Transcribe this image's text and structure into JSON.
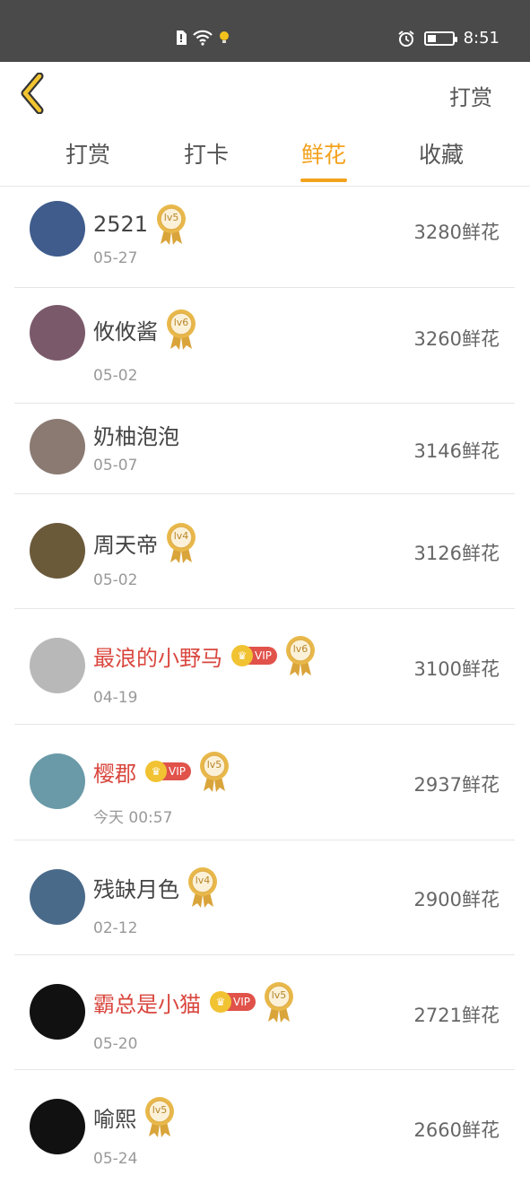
{
  "status_bar": {
    "time": "8:51",
    "battery_level": 0.35
  },
  "header": {
    "action_label": "打赏"
  },
  "tabs": [
    {
      "label": "打赏",
      "active": false
    },
    {
      "label": "打卡",
      "active": false
    },
    {
      "label": "鲜花",
      "active": true
    },
    {
      "label": "收藏",
      "active": false
    }
  ],
  "colors": {
    "accent": "#f3a21d",
    "vip_name": "#d9473f"
  },
  "list": [
    {
      "name": "2521",
      "vip": false,
      "level": "lv5",
      "date": "05-27",
      "amount": "3280鲜花",
      "avatar_bg": "#3f5c8c"
    },
    {
      "name": "攸攸酱",
      "vip": false,
      "level": "lv6",
      "date": "05-02",
      "amount": "3260鲜花",
      "avatar_bg": "#7a5a6a"
    },
    {
      "name": "奶柚泡泡",
      "vip": false,
      "level": "",
      "date": "05-07",
      "amount": "3146鲜花",
      "avatar_bg": "#8a7a72"
    },
    {
      "name": "周天帝",
      "vip": false,
      "level": "lv4",
      "date": "05-02",
      "amount": "3126鲜花",
      "avatar_bg": "#6b5a3a"
    },
    {
      "name": "最浪的小野马",
      "vip": true,
      "vip_label": "VIP",
      "level": "lv6",
      "date": "04-19",
      "amount": "3100鲜花",
      "avatar_bg": "#b8b8b8"
    },
    {
      "name": "樱郡",
      "vip": true,
      "vip_label": "VIP",
      "level": "lv5",
      "date": "今天 00:57",
      "amount": "2937鲜花",
      "avatar_bg": "#6a9aa8"
    },
    {
      "name": "残缺月色",
      "vip": false,
      "level": "lv4",
      "date": "02-12",
      "amount": "2900鲜花",
      "avatar_bg": "#4a6a8a"
    },
    {
      "name": "霸总是小猫",
      "vip": true,
      "vip_label": "VIP",
      "level": "lv5",
      "date": "05-20",
      "amount": "2721鲜花",
      "avatar_bg": "#111111"
    },
    {
      "name": "喻熙",
      "vip": false,
      "level": "lv5",
      "date": "05-24",
      "amount": "2660鲜花",
      "avatar_bg": "#111111"
    }
  ]
}
